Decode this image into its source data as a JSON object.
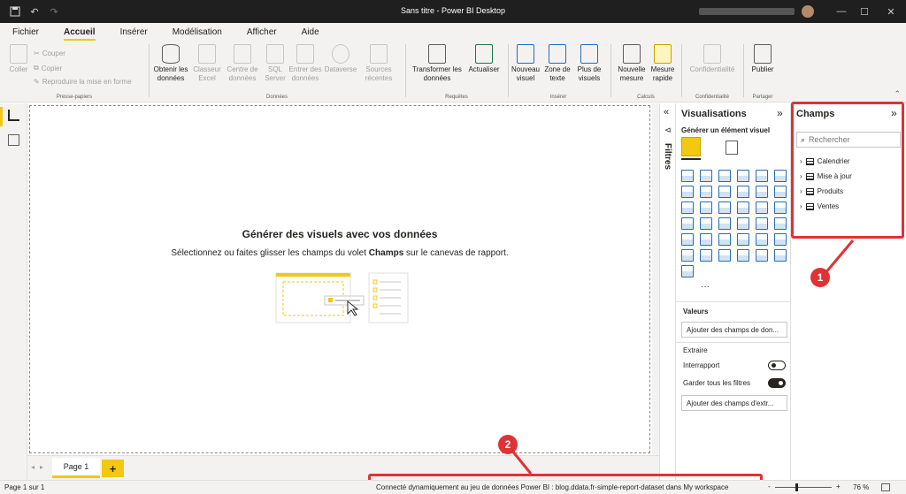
{
  "window": {
    "title": "Sans titre - Power BI Desktop",
    "minimize": "—",
    "maximize": "☐",
    "close": "✕"
  },
  "menu": [
    {
      "label": "Fichier"
    },
    {
      "label": "Accueil"
    },
    {
      "label": "Insérer"
    },
    {
      "label": "Modélisation"
    },
    {
      "label": "Afficher"
    },
    {
      "label": "Aide"
    }
  ],
  "ribbon": {
    "paste": "Coller",
    "cut": "Couper",
    "copy": "Copier",
    "format_painter": "Reproduire la mise en forme",
    "clipboard_group": "Presse-papiers",
    "get_data": "Obtenir les données",
    "excel": "Classeur Excel",
    "data_hub": "Centre de données",
    "sql": "SQL Server",
    "enter_data": "Entrer des données",
    "dataverse": "Dataverse",
    "recent_sources": "Sources récentes",
    "data_group": "Données",
    "transform": "Transformer les données",
    "refresh": "Actualiser",
    "queries_group": "Requêtes",
    "new_visual": "Nouveau visuel",
    "text_box": "Zone de texte",
    "more_visuals": "Plus de visuels",
    "insert_group": "Insérer",
    "new_measure": "Nouvelle mesure",
    "quick_measure": "Mesure rapide",
    "calc_group": "Calculs",
    "sensitivity": "Confidentialité",
    "sensitivity_group": "Confidentialité",
    "publish": "Publier",
    "share_group": "Partager"
  },
  "canvas": {
    "title": "Générer des visuels avec vos données",
    "subtitle_before": "Sélectionnez ou faites glisser les champs du volet ",
    "subtitle_bold": "Champs",
    "subtitle_after": " sur le canevas de rapport."
  },
  "pages": {
    "tab": "Page 1",
    "add": "+"
  },
  "filters": {
    "label": "Filtres"
  },
  "visualizations": {
    "title": "Visualisations",
    "build_label": "Générer un élément visuel",
    "more": "···",
    "values_label": "Valeurs",
    "values_placeholder": "Ajouter des champs de don...",
    "drill_label": "Extraire",
    "cross_report": "Interrapport",
    "keep_filters": "Garder tous les filtres",
    "drill_placeholder": "Ajouter des champs d'extr...",
    "cross_report_on": false,
    "keep_filters_on": true
  },
  "fields": {
    "title": "Champs",
    "search_placeholder": "Rechercher",
    "tables": [
      "Calendrier",
      "Mise à jour",
      "Produits",
      "Ventes"
    ]
  },
  "annotations": {
    "badge1": "1",
    "badge2": "2"
  },
  "status": {
    "page": "Page 1 sur 1",
    "connection": "Connecté dynamiquement au jeu de données Power BI : blog.ddata.fr-simple-report-dataset dans My workspace",
    "zoom": "76 %",
    "minus": "-",
    "plus": "+"
  },
  "colors": {
    "accent": "#f2c811",
    "annotation_red": "#e03234"
  }
}
